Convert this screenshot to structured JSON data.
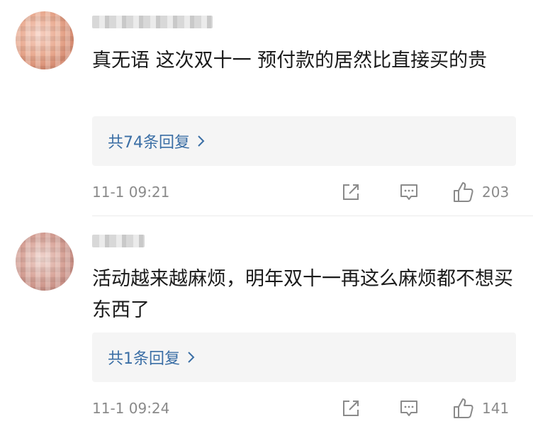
{
  "comments": [
    {
      "text": "真无语 这次双十一 预付款的居然比直接买的贵",
      "reply_label": "共74条回复",
      "time": "11-1 09:21",
      "likes": "203"
    },
    {
      "text": "活动越来越麻烦，明年双十一再这么麻烦都不想买东西了",
      "reply_label": "共1条回复",
      "time": "11-1 09:24",
      "likes": "141"
    }
  ],
  "icons": {
    "share": "share-icon",
    "comment": "comment-icon",
    "like": "thumbs-up-icon",
    "chevron": "chevron-right-icon"
  },
  "colors": {
    "reply_link": "#3a6ea5",
    "meta_gray": "#8a8a8a",
    "reply_bg": "#f5f5f5"
  }
}
